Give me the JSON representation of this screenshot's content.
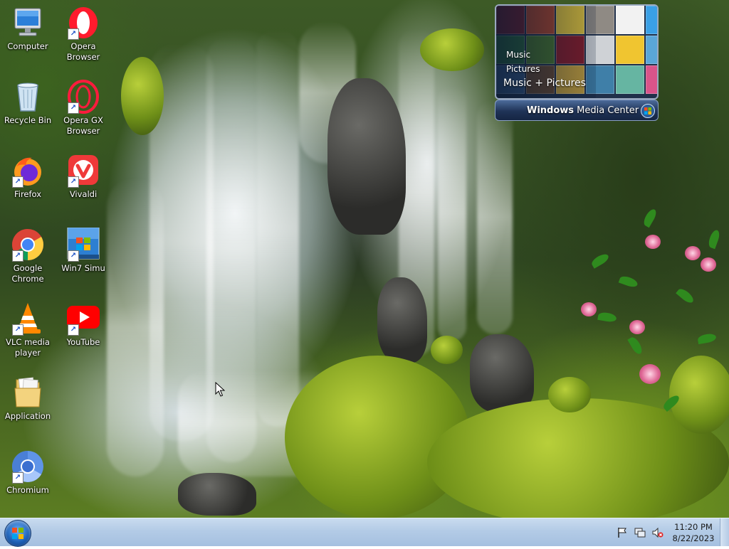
{
  "desktop_icons": [
    {
      "label_line1": "Computer",
      "label_line2": "",
      "icon": "computer-icon"
    },
    {
      "label_line1": "Opera",
      "label_line2": "Browser",
      "icon": "opera-icon"
    },
    {
      "label_line1": "Recycle Bin",
      "label_line2": "",
      "icon": "recycle-bin-icon"
    },
    {
      "label_line1": "Opera GX",
      "label_line2": "Browser",
      "icon": "opera-gx-icon"
    },
    {
      "label_line1": "Firefox",
      "label_line2": "",
      "icon": "firefox-icon"
    },
    {
      "label_line1": "Vivaldi",
      "label_line2": "",
      "icon": "vivaldi-icon"
    },
    {
      "label_line1": "Google",
      "label_line2": "Chrome",
      "icon": "chrome-icon"
    },
    {
      "label_line1": "Win7 Simu",
      "label_line2": "",
      "icon": "win7-simu-icon"
    },
    {
      "label_line1": "VLC media",
      "label_line2": "player",
      "icon": "vlc-icon"
    },
    {
      "label_line1": "YouTube",
      "label_line2": "",
      "icon": "youtube-icon"
    },
    {
      "label_line1": "Application",
      "label_line2": "",
      "icon": "folder-icon"
    },
    {
      "label_line1": "Chromium",
      "label_line2": "",
      "icon": "chromium-icon"
    }
  ],
  "wmc_gadget": {
    "menu_item_1": "Music",
    "menu_item_2": "Pictures",
    "selected": "Music + Pictures",
    "brand_bold": "Windows",
    "brand_rest": " Media Center"
  },
  "taskbar": {
    "time": "11:20 PM",
    "date": "8/22/2023",
    "tray_icons": [
      "action-center-flag-icon",
      "network-icon",
      "volume-muted-icon"
    ]
  },
  "colors": {
    "taskbar": "#b3cbe6",
    "wmc_bar": "#1f3357"
  }
}
